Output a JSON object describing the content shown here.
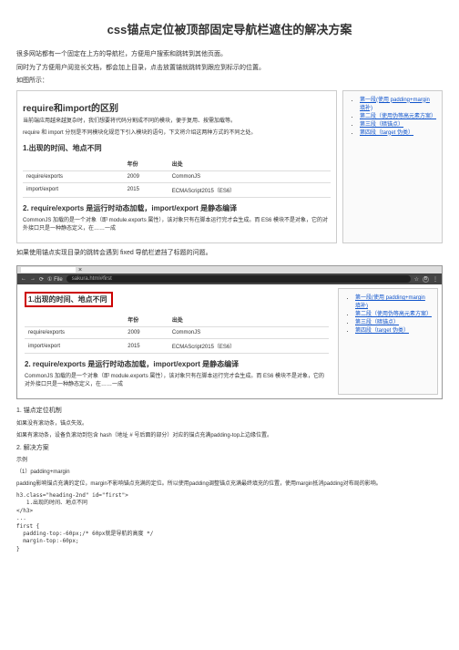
{
  "title": "css锚点定位被顶部固定导航栏遮住的解决方案",
  "intro": [
    "很多网站都有一个固定在上方的导航栏，方便用户搜索和跳转到其他页面。",
    "同时为了方便用户阅览长文档，都会加上目录，点击放置锚就跳转到跟应到标示的位置。",
    "如图所示："
  ],
  "article": {
    "h1": "require和import的区别",
    "p1": "当前端应用越来越复杂时，我们想要将代码分割成不同的模块，便于复用、按需加载等。",
    "p2": "require 和 import 分别是不同模块化规范下引入模块的语句，下文将介绍这两种方式的不同之处。",
    "h2a": "1.出现的时间、地点不同",
    "table": {
      "headers": [
        "",
        "年份",
        "出处"
      ],
      "rows": [
        [
          "require/exports",
          "2009",
          "CommonJS"
        ],
        [
          "import/export",
          "2015",
          "ECMAScript2015（ES6）"
        ]
      ]
    },
    "h2b": "2. require/exports 是运行时动态加载，import/export 是静态编译",
    "p3": "CommonJS 加载的是一个对象（即 module.exports 属性），该对象只有在脚本运行完才会生成。而 ES6 模块不是对象，它的对外接口只是一种静态定义，在……一成"
  },
  "sidebar": {
    "items": [
      "第一段(使用 padding+margin 填补)",
      "第二段（使用伪等高元素方案）",
      "第三段（暗锚点）",
      "第四段（target 伪类）"
    ]
  },
  "midline": "如果使用锚点实现目录的跳转会遇到 fixed 导航栏遮挡了标题的问题。",
  "browser": {
    "url": "sakura.html#first"
  },
  "viewport": {
    "highlight": "1.出现的时间、地点不同",
    "table": {
      "headers": [
        "",
        "年份",
        "出处"
      ],
      "rows": [
        [
          "require/exports",
          "2009",
          "CommonJS"
        ],
        [
          "import/export",
          "2015",
          "ECMAScript2015（ES6）"
        ]
      ]
    },
    "h2b": "2. require/exports 是运行时动态加载，import/export 是静态编译",
    "p3": "CommonJS 加载的是一个对象（即 module.exports 属性），该对象只有在脚本运行完才会生成。而 ES6 模块不是对象，它的对外接口只是一种静态定义，在……一成"
  },
  "solutions": {
    "s1_title": "1. 锚点定位机制",
    "s1_a": "如果没有滚动条，锚点失效。",
    "s1_b": "如果有滚动条，设备负滚动到包含 hash（地址 # 号后面的部分）对应的锚点充满padding-top上边缘位置。",
    "s2_title": "2. 解决方案",
    "s2_sub": "示例",
    "s2_a": "（1）padding+margin",
    "s2_b": "padding影响锚点充满的定位，margin不影响锚点充满的定位。所以使用padding调整锚点充满最终填充的位置，使用margin抵消padding对布局的影响。",
    "code": "h3.class=\"heading-2nd\" id=\"first\">\n   1.出现的时间、地点不同\n</h3>\n...\nfirst {\n  padding-top:-60px;/* 60px就是导航的高度 */\n  margin-top:-60px;\n}"
  }
}
